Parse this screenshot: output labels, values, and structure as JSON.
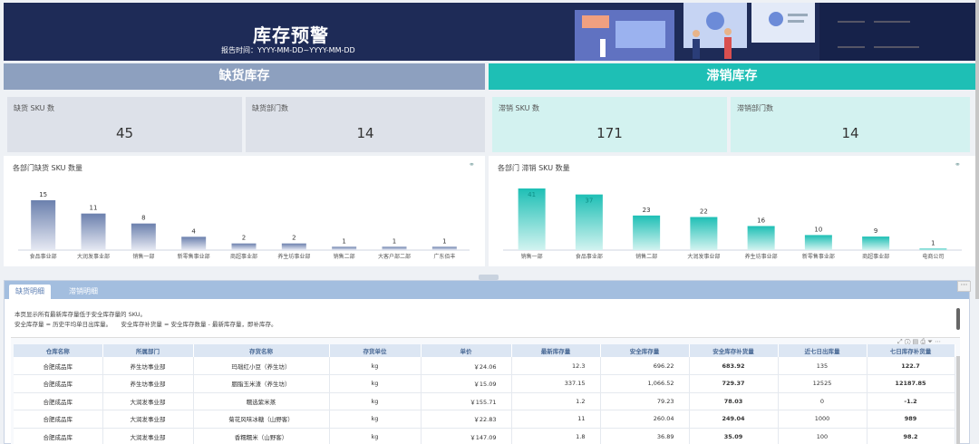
{
  "header": {
    "title": "库存预警",
    "subtitle": "报告时间：YYYY-MM-DD~YYYY-MM-DD"
  },
  "shortage": {
    "section_title": "缺货库存",
    "kpis": [
      {
        "label": "缺货 SKU 数",
        "value": "45"
      },
      {
        "label": "缺货部门数",
        "value": "14"
      }
    ],
    "chart_title": "各部门缺货 SKU 数量"
  },
  "slow": {
    "section_title": "滞销库存",
    "kpis": [
      {
        "label": "滞销 SKU 数",
        "value": "171"
      },
      {
        "label": "滞销部门数",
        "value": "14"
      }
    ],
    "chart_title": "各部门 滞销 SKU 数量"
  },
  "chart_data": [
    {
      "type": "bar",
      "title": "各部门缺货 SKU 数量",
      "categories": [
        "食品事业部",
        "大润发事业部",
        "销售一部",
        "新零售事业部",
        "商超事业部",
        "养生坊事业部",
        "销售二部",
        "大客户部二部",
        "广东佰丰"
      ],
      "values": [
        15,
        11,
        8,
        4,
        2,
        2,
        1,
        1,
        1
      ],
      "ylim": [
        0,
        15
      ],
      "color": "#6b80ad",
      "grid": false
    },
    {
      "type": "bar",
      "title": "各部门 滞销 SKU 数量",
      "categories": [
        "销售一部",
        "食品事业部",
        "销售二部",
        "大润发事业部",
        "养生坊事业部",
        "新零售事业部",
        "商超事业部",
        "电商公司"
      ],
      "values": [
        41,
        37,
        23,
        22,
        16,
        10,
        9,
        1
      ],
      "ylim": [
        0,
        41
      ],
      "color": "#1ebfb5",
      "grid": false
    }
  ],
  "tabs": [
    "缺货明细",
    "滞销明细"
  ],
  "description": [
    "本页显示所有最新库存量低于安全库存量的 SKU。",
    "安全库存量 = 历史平均单日出库量。     安全库存补货量 = 安全库存数量 - 最新库存量，即补库存。"
  ],
  "table": {
    "columns": [
      "仓库名称",
      "所属部门",
      "存货名称",
      "存货单位",
      "单价",
      "最新库存量",
      "安全库存量",
      "安全库存补货量",
      "近七日出库量",
      "七日库存补货量"
    ],
    "rows": [
      [
        "合肥成品库",
        "养生坊事业部",
        "玛瑙红小豆（养生坊）",
        "kg",
        "￥24.06",
        "12.3",
        "696.22",
        "683.92",
        "135",
        "122.7"
      ],
      [
        "合肥成品库",
        "养生坊事业部",
        "胭脂玉米渣（养生坊）",
        "kg",
        "￥15.09",
        "337.15",
        "1,066.52",
        "729.37",
        "12525",
        "12187.85"
      ],
      [
        "合肥成品库",
        "大润发事业部",
        "糯选紫米蒸",
        "kg",
        "￥155.71",
        "1.2",
        "79.23",
        "78.03",
        "0",
        "-1.2"
      ],
      [
        "合肥成品库",
        "大润发事业部",
        "菊花风味冰糖（山野客）",
        "kg",
        "￥22.83",
        "11",
        "260.04",
        "249.04",
        "1000",
        "989"
      ],
      [
        "合肥成品库",
        "大润发事业部",
        "香糯糯米（山野客）",
        "kg",
        "￥147.09",
        "1.8",
        "36.89",
        "35.09",
        "100",
        "98.2"
      ]
    ]
  }
}
